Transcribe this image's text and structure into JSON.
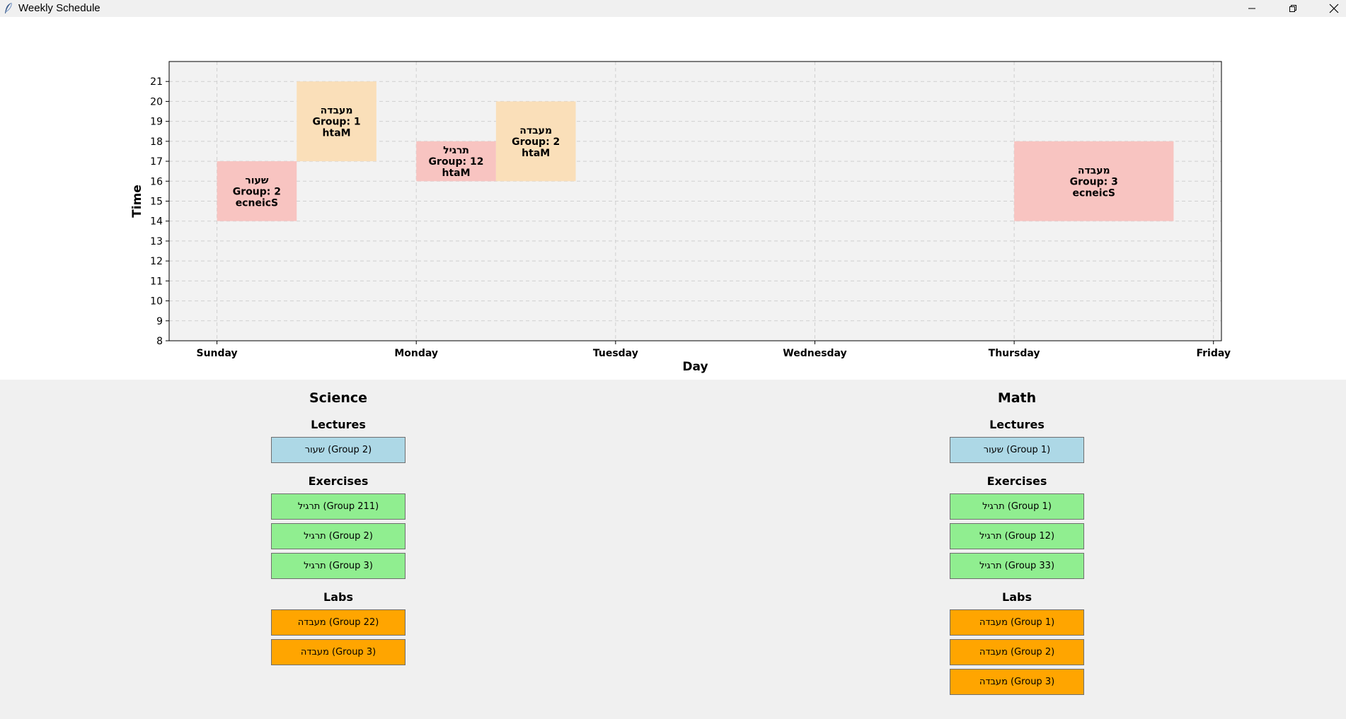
{
  "window": {
    "title": "Weekly Schedule"
  },
  "chart_data": {
    "type": "schedule-blocks",
    "xlabel": "Day",
    "ylabel": "Time",
    "days": [
      "Sunday",
      "Monday",
      "Tuesday",
      "Wednesday",
      "Thursday",
      "Friday"
    ],
    "hours": [
      8,
      9,
      10,
      11,
      12,
      13,
      14,
      15,
      16,
      17,
      18,
      19,
      20,
      21
    ],
    "ylim": [
      8,
      22
    ],
    "xlim": [
      -0.24,
      5.04
    ],
    "grid": true,
    "colors": {
      "lecture": "#f8c4c1",
      "exercise": "#f8c4c1",
      "lab_orange": "#fadfb9",
      "lab_red": "#f8c4c1"
    },
    "blocks": [
      {
        "day": 0,
        "start": 14,
        "end": 17,
        "width": 0.4,
        "offset": 0,
        "lines": [
          "שעור",
          "Group: 2",
          "ecneicS"
        ],
        "color": "#f8c4c1"
      },
      {
        "day": 0,
        "start": 17,
        "end": 21,
        "width": 0.4,
        "offset": 0.4,
        "lines": [
          "מעבדה",
          "Group: 1",
          "htaM"
        ],
        "color": "#fadfb9"
      },
      {
        "day": 1,
        "start": 16,
        "end": 18,
        "width": 0.4,
        "offset": 0,
        "lines": [
          "תרגיל",
          "Group: 12",
          "htaM"
        ],
        "color": "#f8c4c1"
      },
      {
        "day": 1,
        "start": 16,
        "end": 20,
        "width": 0.4,
        "offset": 0.4,
        "lines": [
          "מעבדה",
          "Group: 2",
          "htaM"
        ],
        "color": "#fadfb9"
      },
      {
        "day": 4,
        "start": 14,
        "end": 18,
        "width": 0.8,
        "offset": 0,
        "lines": [
          "מעבדה",
          "Group: 3",
          "ecneicS"
        ],
        "color": "#f8c4c1"
      }
    ]
  },
  "science": {
    "title": "Science",
    "lectures_heading": "Lectures",
    "lectures": [
      "שעור (Group 2)"
    ],
    "exercises_heading": "Exercises",
    "exercises": [
      "תרגיל (Group 211)",
      "תרגיל (Group 2)",
      "תרגיל (Group 3)"
    ],
    "labs_heading": "Labs",
    "labs": [
      "מעבדה (Group 22)",
      "מעבדה (Group 3)"
    ]
  },
  "math": {
    "title": "Math",
    "lectures_heading": "Lectures",
    "lectures": [
      "שעור (Group 1)"
    ],
    "exercises_heading": "Exercises",
    "exercises": [
      "תרגיל (Group 1)",
      "תרגיל (Group 12)",
      "תרגיל (Group 33)"
    ],
    "labs_heading": "Labs",
    "labs": [
      "מעבדה (Group 1)",
      "מעבדה (Group 2)",
      "מעבדה (Group 3)"
    ]
  }
}
